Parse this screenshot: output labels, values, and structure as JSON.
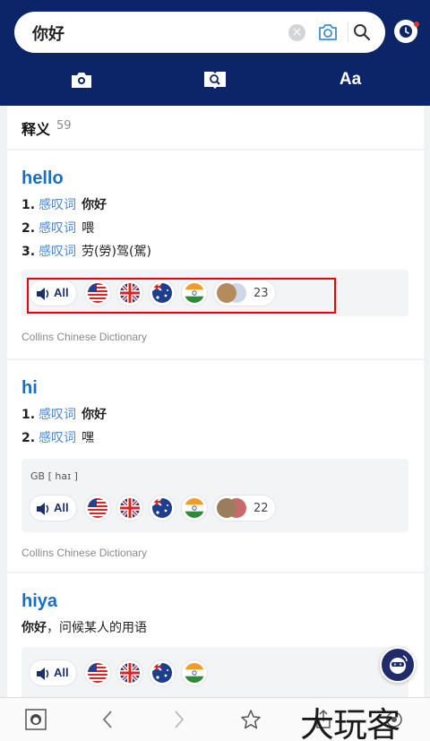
{
  "search": {
    "value": "你好"
  },
  "tabs": [
    "photo-search",
    "picture-dictionary",
    "Aa"
  ],
  "tab_aa_label": "Aa",
  "section": {
    "title": "释义",
    "count": "59"
  },
  "entries": [
    {
      "word": "hello",
      "senses": [
        {
          "num": "1.",
          "pos": "感叹词",
          "text": "你好",
          "bold": true
        },
        {
          "num": "2.",
          "pos": "感叹词",
          "text": "喂",
          "bold": false
        },
        {
          "num": "3.",
          "pos": "感叹词",
          "text": "劳(勞)驾(駕)",
          "bold": false
        }
      ],
      "audio": {
        "all_label": "All",
        "more_count": "23"
      },
      "source": "Collins Chinese Dictionary"
    },
    {
      "word": "hi",
      "senses": [
        {
          "num": "1.",
          "pos": "感叹词",
          "text": "你好",
          "bold": true
        },
        {
          "num": "2.",
          "pos": "感叹词",
          "text": "嘿",
          "bold": false
        }
      ],
      "phonetic": "GB [ haɪ ]",
      "audio": {
        "all_label": "All",
        "more_count": "22"
      },
      "source": "Collins Chinese Dictionary"
    },
    {
      "word": "hiya",
      "definition_bold": "你好",
      "definition_rest": "，问候某人的用语",
      "audio": {
        "all_label": "All"
      }
    }
  ],
  "flags": [
    "us-flag",
    "uk-flag",
    "australia-flag",
    "india-flag"
  ],
  "watermark": "大玩客",
  "colors": {
    "header": "#0c2468",
    "link_blue": "#1a6fc1",
    "pos_blue": "#4a88d2",
    "highlight": "#e00000"
  }
}
